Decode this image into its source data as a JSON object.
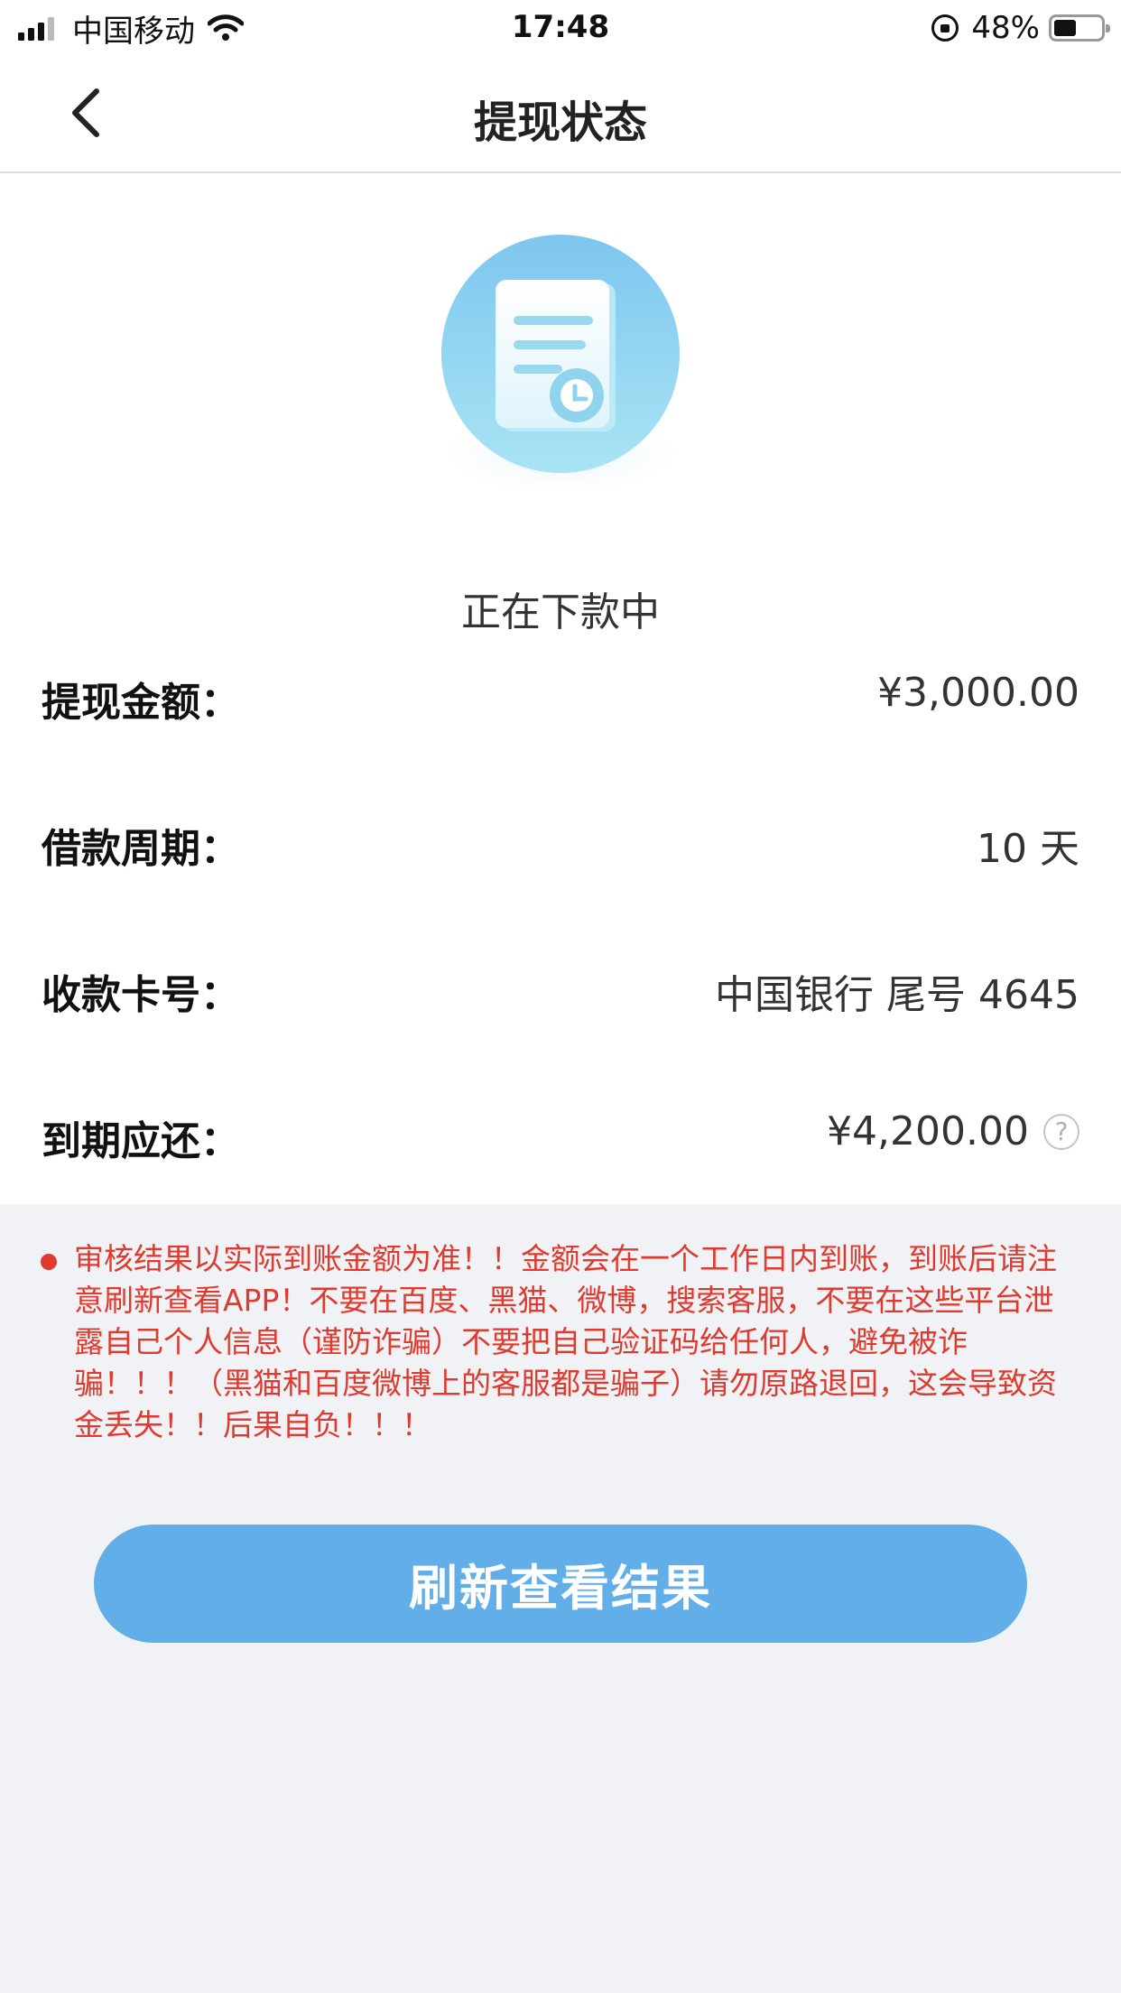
{
  "status_bar": {
    "carrier": "中国移动",
    "time": "17:48",
    "battery_percent": "48%",
    "battery_level": 0.48,
    "icons": [
      "signal-icon",
      "wifi-icon",
      "rotation-lock-icon",
      "battery-icon"
    ]
  },
  "nav": {
    "title": "提现状态",
    "back_icon": "chevron-left-icon"
  },
  "status": {
    "icon": "document-clock-icon",
    "text": "正在下款中"
  },
  "details": [
    {
      "label": "提现金额：",
      "value": "¥3,000.00"
    },
    {
      "label": "借款周期：",
      "value": "10 天"
    },
    {
      "label": "收款卡号：",
      "value": "中国银行 尾号 4645"
    },
    {
      "label": "到期应还：",
      "value": "¥4,200.00",
      "icon": "help-icon"
    }
  ],
  "notice": {
    "text": "审核结果以实际到账金额为准！！金额会在一个工作日内到账，到账后请注意刷新查看APP！不要在百度、黑猫、微博，搜索客服，不要在这些平台泄露自己个人信息（谨防诈骗）不要把自己验证码给任何人，避免被诈骗！！！（黑猫和百度微博上的客服都是骗子）请勿原路退回，这会导致资金丢失！！后果自负！！！",
    "color": "#e03a2e"
  },
  "button": {
    "label": "刷新查看结果",
    "color": "#62aee8"
  }
}
